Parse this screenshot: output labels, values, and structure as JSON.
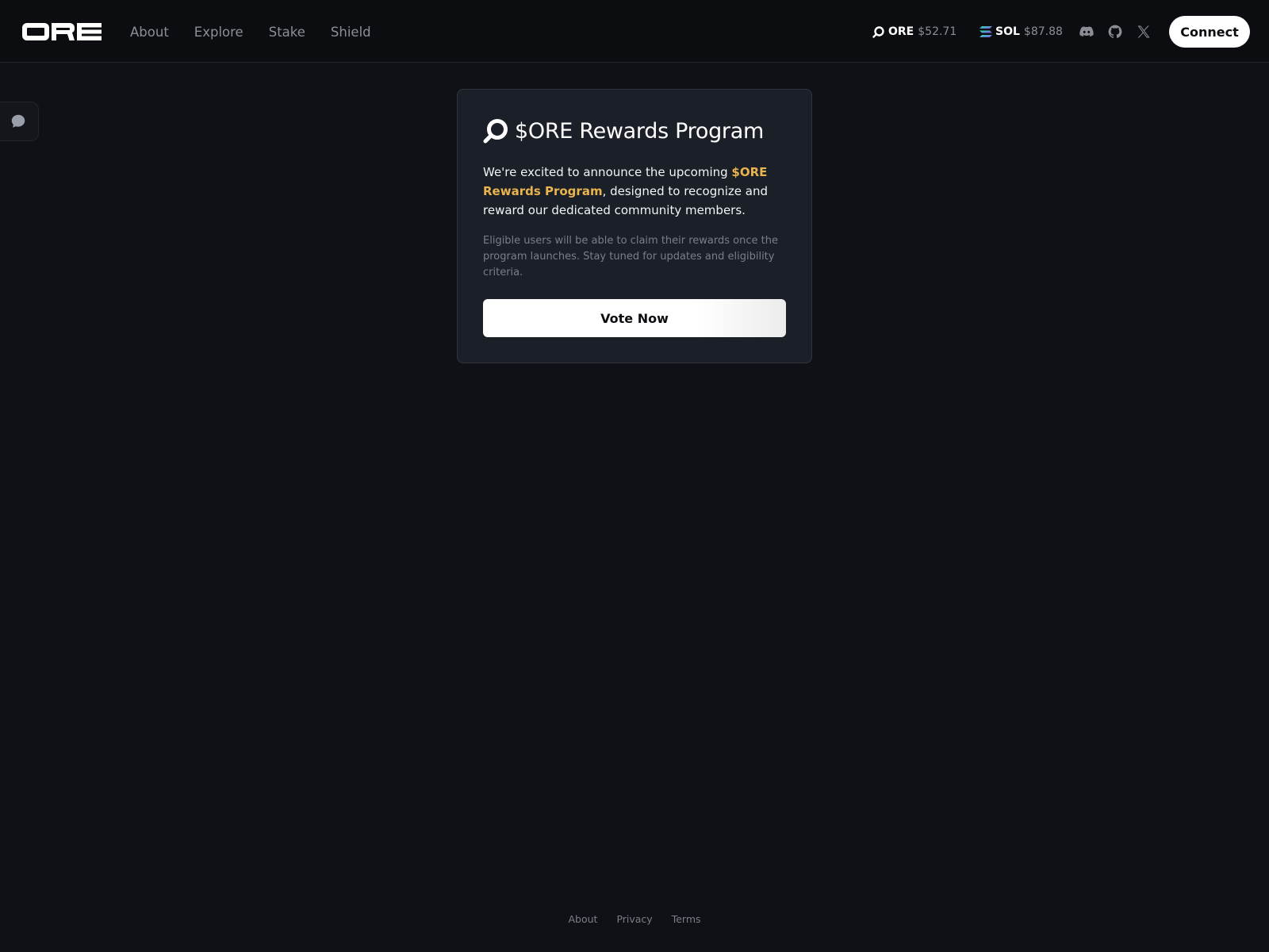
{
  "header": {
    "logo_text": "ORE",
    "nav": [
      {
        "label": "About"
      },
      {
        "label": "Explore"
      },
      {
        "label": "Stake"
      },
      {
        "label": "Shield"
      }
    ],
    "tickers": [
      {
        "symbol": "ORE",
        "price": "$52.71",
        "icon": "ore-icon"
      },
      {
        "symbol": "SOL",
        "price": "$87.88",
        "icon": "solana-icon"
      }
    ],
    "social_icons": [
      "discord-icon",
      "github-icon",
      "x-icon"
    ],
    "connect_label": "Connect"
  },
  "sidebar": {
    "chat_icon": "chat-bubble-icon"
  },
  "card": {
    "title": "$ORE Rewards Program",
    "intro_before": "We're excited to announce the upcoming ",
    "intro_highlight": "$ORE Rewards Program",
    "intro_after": ", designed to recognize and reward our dedicated community members.",
    "note": "Eligible users will be able to claim their rewards once the program launches. Stay tuned for updates and eligibility criteria.",
    "button_label": "Vote Now",
    "highlight_color": "#e8b44f"
  },
  "footer": {
    "links": [
      {
        "label": "About"
      },
      {
        "label": "Privacy"
      },
      {
        "label": "Terms"
      }
    ]
  }
}
